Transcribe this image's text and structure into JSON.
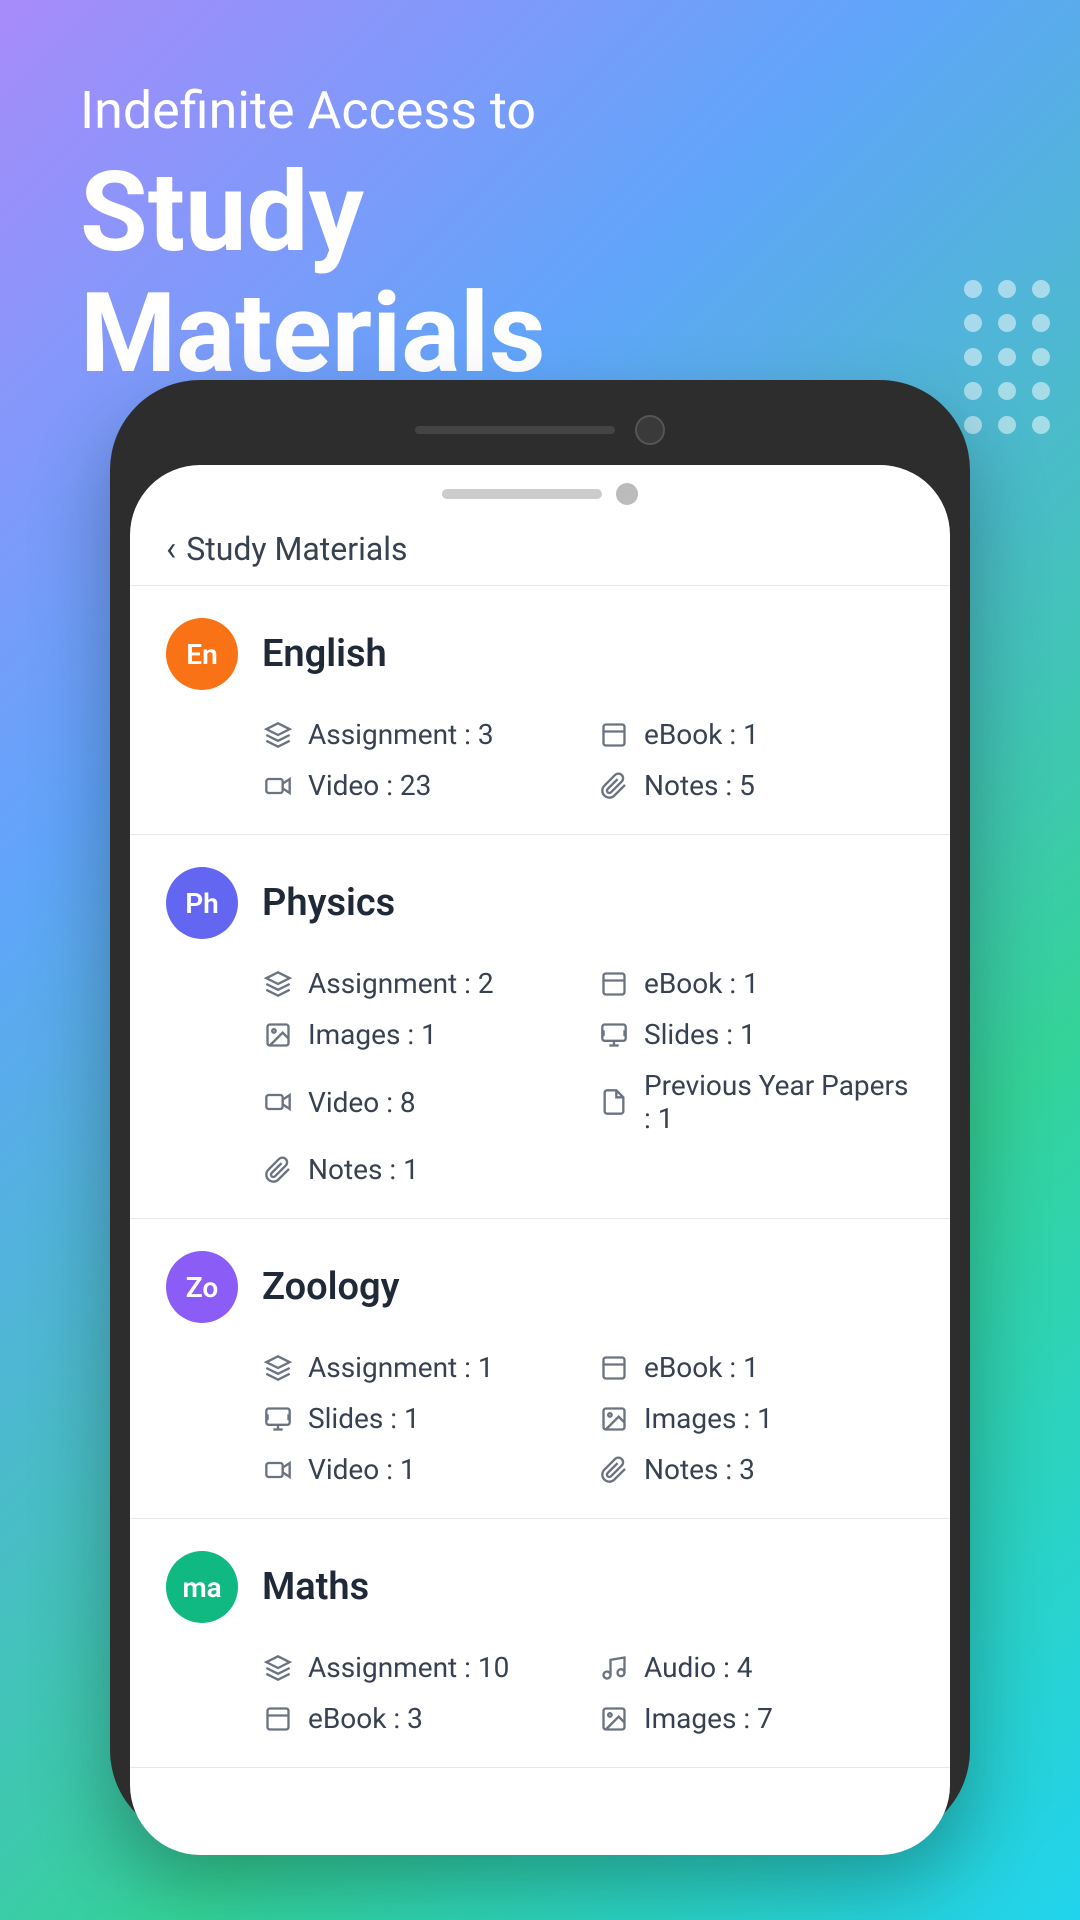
{
  "background": {
    "gradient_start": "#a78bfa",
    "gradient_end": "#22d3ee"
  },
  "hero": {
    "subtitle": "Indefinite Access to",
    "title_line1": "Study",
    "title_line2": "Materials"
  },
  "screen": {
    "back_label": "Study Materials",
    "subjects": [
      {
        "id": "english",
        "name": "English",
        "avatar_text": "En",
        "avatar_color": "avatar-orange",
        "stats": [
          {
            "icon": "layers",
            "label": "Assignment : 3"
          },
          {
            "icon": "book",
            "label": "eBook : 1"
          },
          {
            "icon": "video",
            "label": "Video : 23"
          },
          {
            "icon": "paperclip",
            "label": "Notes : 5"
          }
        ]
      },
      {
        "id": "physics",
        "name": "Physics",
        "avatar_text": "Ph",
        "avatar_color": "avatar-blue",
        "stats": [
          {
            "icon": "layers",
            "label": "Assignment : 2"
          },
          {
            "icon": "book",
            "label": "eBook : 1"
          },
          {
            "icon": "image",
            "label": "Images : 1"
          },
          {
            "icon": "slides",
            "label": "Slides : 1"
          },
          {
            "icon": "video",
            "label": "Video : 8"
          },
          {
            "icon": "file",
            "label": "Previous Year Papers : 1"
          },
          {
            "icon": "paperclip",
            "label": "Notes : 1"
          }
        ]
      },
      {
        "id": "zoology",
        "name": "Zoology",
        "avatar_text": "Zo",
        "avatar_color": "avatar-purple",
        "stats": [
          {
            "icon": "layers",
            "label": "Assignment : 1"
          },
          {
            "icon": "book",
            "label": "eBook : 1"
          },
          {
            "icon": "slides",
            "label": "Slides : 1"
          },
          {
            "icon": "image",
            "label": "Images : 1"
          },
          {
            "icon": "video",
            "label": "Video : 1"
          },
          {
            "icon": "paperclip",
            "label": "Notes : 3"
          }
        ]
      },
      {
        "id": "maths",
        "name": "Maths",
        "avatar_text": "ma",
        "avatar_color": "avatar-green",
        "stats": [
          {
            "icon": "layers",
            "label": "Assignment : 10"
          },
          {
            "icon": "audio",
            "label": "Audio : 4"
          },
          {
            "icon": "book",
            "label": "eBook : 3"
          },
          {
            "icon": "image",
            "label": "Images : 7"
          }
        ]
      }
    ]
  }
}
